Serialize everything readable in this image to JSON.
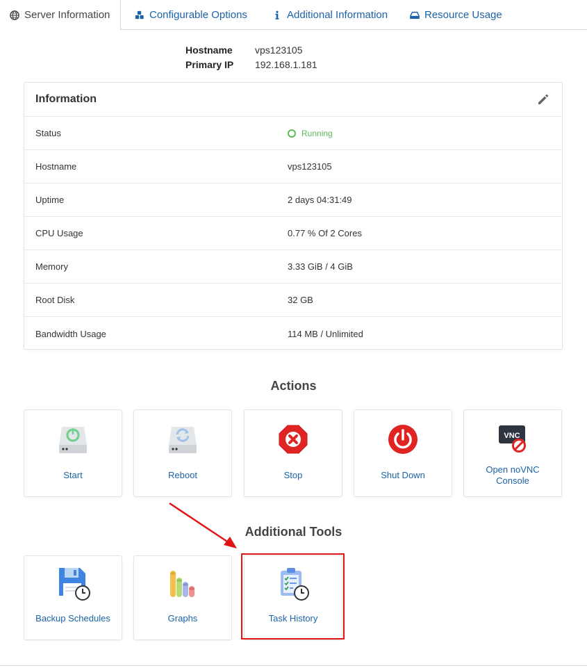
{
  "tabs": [
    {
      "label": "Server Information",
      "icon": "globe-icon"
    },
    {
      "label": "Configurable Options",
      "icon": "cubes-icon"
    },
    {
      "label": "Additional Information",
      "icon": "info-icon"
    },
    {
      "label": "Resource Usage",
      "icon": "hdd-icon"
    }
  ],
  "header": {
    "hostname_label": "Hostname",
    "hostname_value": "vps123105",
    "ip_label": "Primary IP",
    "ip_value": "192.168.1.181"
  },
  "info_panel": {
    "title": "Information",
    "rows": [
      {
        "label": "Status",
        "value": "Running"
      },
      {
        "label": "Hostname",
        "value": "vps123105"
      },
      {
        "label": "Uptime",
        "value": "2 days 04:31:49"
      },
      {
        "label": "CPU Usage",
        "value": "0.77 % Of 2 Cores"
      },
      {
        "label": "Memory",
        "value": "3.33 GiB / 4 GiB"
      },
      {
        "label": "Root Disk",
        "value": "32 GB"
      },
      {
        "label": "Bandwidth Usage",
        "value": "114 MB / Unlimited"
      }
    ]
  },
  "actions": {
    "title": "Actions",
    "items": [
      {
        "label": "Start",
        "icon": "start-server-icon"
      },
      {
        "label": "Reboot",
        "icon": "reboot-server-icon"
      },
      {
        "label": "Stop",
        "icon": "stop-icon"
      },
      {
        "label": "Shut Down",
        "icon": "power-icon"
      },
      {
        "label_line1": "Open noVNC",
        "label_line2": "Console",
        "icon": "vnc-icon",
        "vnc_text": "VNC"
      }
    ]
  },
  "tools": {
    "title": "Additional Tools",
    "items": [
      {
        "label": "Backup Schedules",
        "icon": "backup-schedule-icon"
      },
      {
        "label": "Graphs",
        "icon": "graphs-icon"
      },
      {
        "label": "Task History",
        "icon": "task-history-icon"
      }
    ]
  },
  "colors": {
    "link": "#1b62a8",
    "running": "#5cb85c",
    "highlight": "#e31414",
    "stop_red": "#e02424"
  }
}
